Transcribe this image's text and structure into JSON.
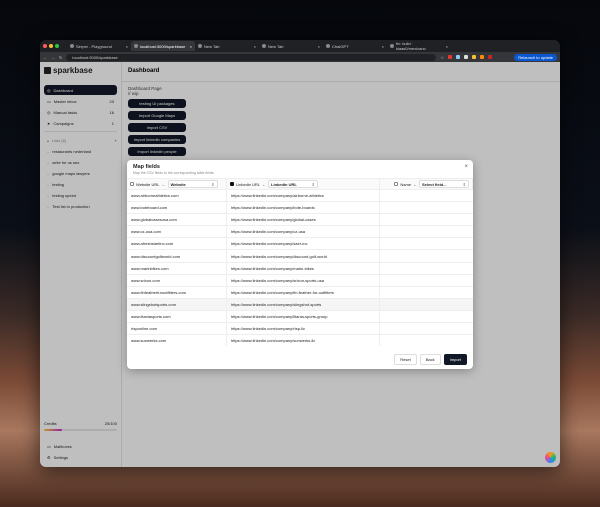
{
  "browser": {
    "tabs": [
      {
        "label": "Serper - Playground"
      },
      {
        "label": "localhost:3000/sparkbase"
      },
      {
        "label": "New Tab"
      },
      {
        "label": "New Tab"
      },
      {
        "label": "ChatGPT"
      },
      {
        "label": "fix: build · klaas0/mexicano"
      }
    ],
    "url": "localhost:3000/sparkbase",
    "relaunch": "Relaunch to update"
  },
  "sidebar": {
    "logo": "sparkbase",
    "nav": [
      {
        "label": "Dashboard",
        "count": ""
      },
      {
        "label": "Master inbox",
        "count": "23"
      },
      {
        "label": "Manual tasks",
        "count": "16"
      },
      {
        "label": "Campaigns",
        "count": "1"
      }
    ],
    "lists_label": "Lists (6)",
    "lists_add": "+",
    "lists": [
      "restaurants nederland",
      "write for us seo",
      "google maps lawyers",
      "testing",
      "testing speed",
      "Test list in production"
    ],
    "credits_label": "Credits",
    "credits_value": "25/100",
    "credits_fraction": 0.25,
    "footer": [
      {
        "label": "Mailboxes"
      },
      {
        "label": "Settings"
      }
    ]
  },
  "main": {
    "title": "Dashboard",
    "page_label": "Dashboard Page",
    "wip": "// wip",
    "buttons": [
      "testing UI packages",
      "Import Google Maps",
      "Import CSV",
      "Import linkedin companies",
      "Import linkedin people"
    ]
  },
  "modal": {
    "title": "Map fields",
    "subtitle": "Map the CSV fields to the corresponding table fields.",
    "close": "×",
    "mappings": [
      {
        "csv": "Website URL",
        "arrow": "←",
        "field": "Website",
        "checked": false
      },
      {
        "csv": "Linkedin URL",
        "arrow": "←",
        "field": "LinkedIn URL",
        "checked": true
      },
      {
        "csv": "Name",
        "arrow": "←",
        "field": "Select field...",
        "checked": false
      }
    ],
    "rows": [
      [
        "www.airborneathletics.com",
        "https://www.linkedin.com/company/airborne-athletics"
      ],
      [
        "www.boteboard.com",
        "https://www.linkedin.com/company/bote-boards"
      ],
      [
        "www.globalcasesusa.com",
        "https://www.linkedin.com/company/global-cases"
      ],
      [
        "www.cz-usa.com",
        "https://www.linkedin.com/company/cz-usa"
      ],
      [
        "www.afreshstartinc.com",
        "https://www.linkedin.com/company/saer-inc"
      ],
      [
        "www.discountgolfworld.com",
        "https://www.linkedin.com/company/discount-golf-world"
      ],
      [
        "www.marinbikes.com",
        "https://www.linkedin.com/company/marin-bikes"
      ],
      [
        "www.srixon.com",
        "https://www.linkedin.com/company/srixon-sports-usa"
      ],
      [
        "www.finfeatherfuroutfitters.com",
        "https://www.linkedin.com/company/fin-feather-fur-outfitters"
      ],
      [
        "www.slingshotsports.com",
        "https://www.linkedin.com/company/slingshot-sports"
      ],
      [
        "www.litaniasports.com",
        "https://www.linkedin.com/company/litania-sports-group"
      ],
      [
        "rtsponline.com",
        "https://www.linkedin.com/company/rtsp-llc"
      ],
      [
        "www.sunwerks.com",
        "https://www.linkedin.com/company/sunwerks-llc"
      ]
    ],
    "reset": "Reset",
    "back": "Back",
    "import": "Import"
  }
}
